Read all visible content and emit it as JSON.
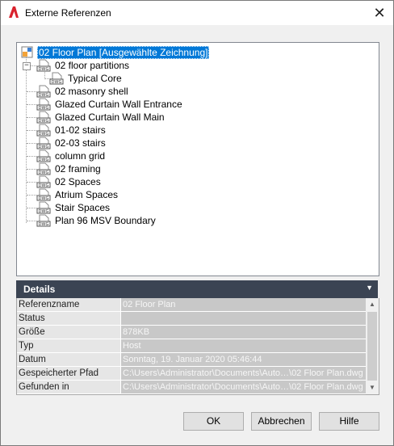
{
  "window": {
    "title": "Externe Referenzen",
    "close_symbol": "✕"
  },
  "tree": {
    "root": "02 Floor Plan [Ausgewählte Zeichnung]",
    "items": [
      {
        "label": "02 floor partitions",
        "icon": "dwg-file-icon"
      },
      {
        "label": "Typical Core",
        "icon": "dwg-file-icon"
      },
      {
        "label": "02 masonry shell",
        "icon": "dwg-file-icon"
      },
      {
        "label": "Glazed Curtain Wall Entrance",
        "icon": "dwg-file-icon"
      },
      {
        "label": "Glazed Curtain Wall Main",
        "icon": "dwg-file-icon"
      },
      {
        "label": "01-02 stairs",
        "icon": "dwg-file-icon"
      },
      {
        "label": "02-03 stairs",
        "icon": "dwg-file-icon"
      },
      {
        "label": "column grid",
        "icon": "dwg-file-icon"
      },
      {
        "label": "02 framing",
        "icon": "dwg-file-icon"
      },
      {
        "label": "02 Spaces",
        "icon": "dwg-file-icon"
      },
      {
        "label": "Atrium Spaces",
        "icon": "dwg-file-icon"
      },
      {
        "label": "Stair Spaces",
        "icon": "dwg-file-icon"
      },
      {
        "label": "Plan 96 MSV Boundary",
        "icon": "dwg-file-icon"
      }
    ]
  },
  "details": {
    "title": "Details",
    "rows": [
      {
        "name": "Referenzname",
        "value": "02 Floor Plan"
      },
      {
        "name": "Status",
        "value": ""
      },
      {
        "name": "Größe",
        "value": "878KB"
      },
      {
        "name": "Typ",
        "value": "Host"
      },
      {
        "name": "Datum",
        "value": "Sonntag, 19. Januar 2020  05:46:44"
      },
      {
        "name": "Gespeicherter Pfad",
        "value": "C:\\Users\\Administrator\\Documents\\Auto…\\02 Floor Plan.dwg"
      },
      {
        "name": "Gefunden in",
        "value": "C:\\Users\\Administrator\\Documents\\Auto…\\02 Floor Plan.dwg"
      }
    ]
  },
  "buttons": {
    "ok": "OK",
    "cancel": "Abbrechen",
    "help": "Hilfe"
  },
  "colors": {
    "selection": "#0078d7",
    "details_header": "#3b4453",
    "autocad_red": "#d9232e"
  }
}
